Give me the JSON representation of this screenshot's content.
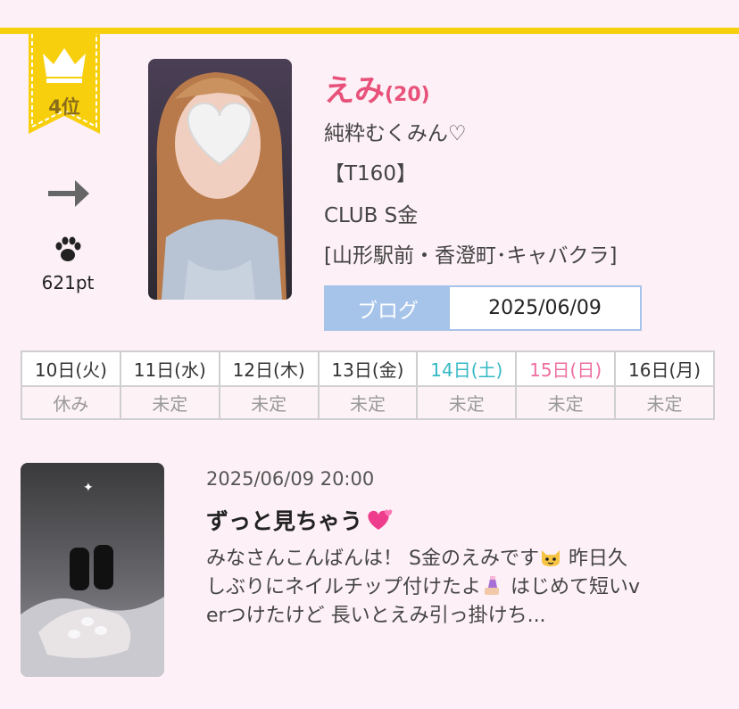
{
  "ranking": {
    "rank_label": "4位",
    "points": "621pt"
  },
  "profile": {
    "name": "えみ",
    "age": "(20)",
    "catchphrase": "純粋むくみん♡",
    "height": "【T160】",
    "club": "CLUB S金",
    "area": "[山形駅前・香澄町･キャバクラ]"
  },
  "blog": {
    "label": "ブログ",
    "date": "2025/06/09"
  },
  "schedule": {
    "days": [
      "10日(火)",
      "11日(水)",
      "12日(木)",
      "13日(金)",
      "14日(土)",
      "15日(日)",
      "16日(月)"
    ],
    "status": [
      "休み",
      "未定",
      "未定",
      "未定",
      "未定",
      "未定",
      "未定"
    ]
  },
  "post": {
    "datetime": "2025/06/09 20:00",
    "title": "ずっと見ちゃう",
    "line1": "みなさんこんばんは！ S金のえみです",
    "line1b": " 昨日久",
    "line2": "しぶりにネイルチップ付けたよ",
    "line2b": " はじめて短いv",
    "line3": "erつけたけど 長いとえみ引っ掛けち..."
  },
  "icons": {
    "crown": "crown-icon",
    "arrow": "arrow-right-icon",
    "paw": "paw-icon",
    "heart": "heart-icon",
    "cat": "cat-emoji-icon",
    "nail": "nail-polish-emoji-icon",
    "hearts": "revolving-hearts-emoji-icon"
  },
  "colors": {
    "accent": "#e8527a",
    "ribbon": "#f7cf0c",
    "blog": "#a6c3ea",
    "saturday": "#35b8c4",
    "sunday": "#ee6da0"
  }
}
